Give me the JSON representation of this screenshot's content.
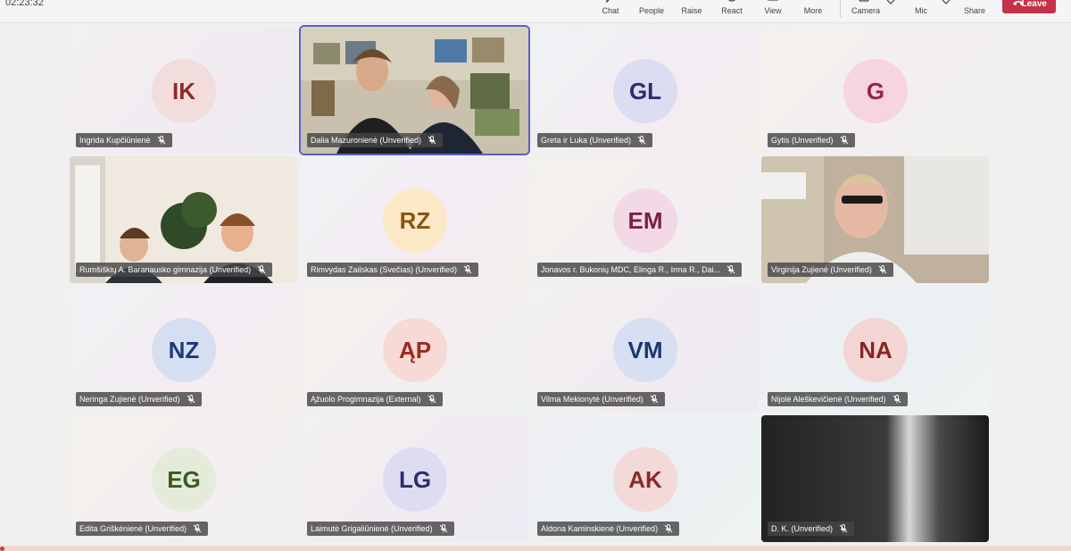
{
  "meeting": {
    "elapsed": "02:23:32"
  },
  "toolbar": {
    "chat": "Chat",
    "people": "People",
    "raise": "Raise",
    "react": "React",
    "view": "View",
    "more": "More",
    "camera": "Camera",
    "mic": "Mic",
    "share": "Share",
    "leave": "Leave"
  },
  "colors": {
    "leave_bg": "#c4314b",
    "selected_outline": "#5b5fc7",
    "nametag_bg": "#464646"
  },
  "tiles": [
    {
      "name": "Ingrida Kupčiūnienė",
      "initials": "IK",
      "type": "avatar",
      "bg": "#f3dcdc",
      "fg": "#8a2b2b"
    },
    {
      "name": "Dalia Mazuronienė (Unverified)",
      "initials": "",
      "type": "video-classroom",
      "selected": true
    },
    {
      "name": "Greta ir Luka (Unverified)",
      "initials": "GL",
      "type": "avatar",
      "bg": "#dcdcf2",
      "fg": "#2b2d6e"
    },
    {
      "name": "Gytis (Unverified)",
      "initials": "G",
      "type": "avatar",
      "bg": "#f6d4e1",
      "fg": "#9b2348"
    },
    {
      "name": "Rumšiškių A. Baranausko gimnazija (Unverified)",
      "initials": "",
      "type": "video-room"
    },
    {
      "name": "Rimvydas Zailskas (Svečias) (Unverified)",
      "initials": "RZ",
      "type": "avatar",
      "bg": "#fbe8c6",
      "fg": "#8a5310"
    },
    {
      "name": "Jonavos r. Bukonių MDC, Elinga R., Irma R., Dai...",
      "initials": "EM",
      "type": "avatar",
      "bg": "#f3d9e5",
      "fg": "#7a1f4a"
    },
    {
      "name": "Virginija Zujienė (Unverified)",
      "initials": "",
      "type": "video-woman"
    },
    {
      "name": "Neringa Zujienė (Unverified)",
      "initials": "NZ",
      "type": "avatar",
      "bg": "#d6dff2",
      "fg": "#1e3a78"
    },
    {
      "name": "Ąžuolo Progimnazija (External)",
      "initials": "ĄP",
      "type": "avatar",
      "bg": "#f7d9d6",
      "fg": "#9c2b1f"
    },
    {
      "name": "Vilma Mekionytė (Unverified)",
      "initials": "VM",
      "type": "avatar",
      "bg": "#d6e0f2",
      "fg": "#1b376d"
    },
    {
      "name": "Nijolė Aleškevičienė (Unverified)",
      "initials": "NA",
      "type": "avatar",
      "bg": "#f3d6d4",
      "fg": "#8a2420"
    },
    {
      "name": "Edita Griškėnienė (Unverified)",
      "initials": "EG",
      "type": "avatar",
      "bg": "#e4ecd9",
      "fg": "#3b5a23"
    },
    {
      "name": "Laimutė Grigaliūnienė (Unverified)",
      "initials": "LG",
      "type": "avatar",
      "bg": "#dddcf1",
      "fg": "#2e2c6f"
    },
    {
      "name": "Aldona Kaminskienė (Unverified)",
      "initials": "AK",
      "type": "avatar",
      "bg": "#f3d9d8",
      "fg": "#8b2a2a"
    },
    {
      "name": "D. K. (Unverified)",
      "initials": "",
      "type": "video-dark"
    }
  ]
}
